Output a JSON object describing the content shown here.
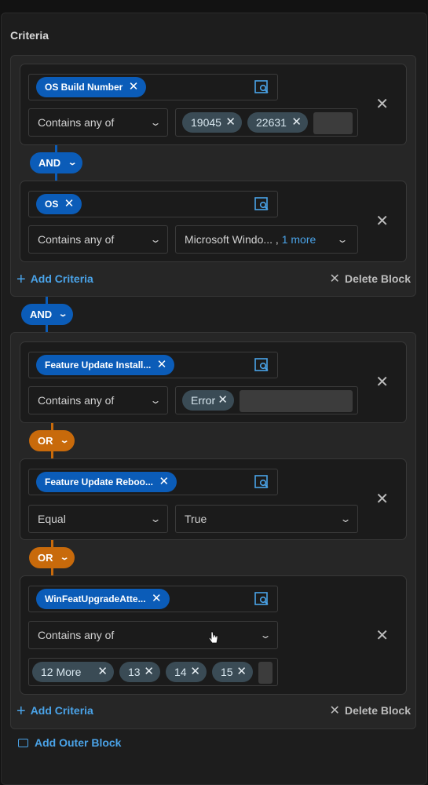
{
  "title": "Criteria",
  "colors": {
    "and": "#0b5cb8",
    "or": "#c86a0b",
    "link": "#4aa3e8"
  },
  "blocks": [
    {
      "criteria": [
        {
          "field": "OS Build Number",
          "operator": "Contains any of",
          "values": [
            "19045",
            "22631"
          ]
        },
        {
          "field": "OS",
          "operator": "Contains any of",
          "value_text": "Microsoft Windo... ,",
          "more": "1 more"
        }
      ],
      "join": "AND",
      "add_label": "Add Criteria",
      "delete_label": "Delete Block"
    },
    {
      "criteria": [
        {
          "field": "Feature Update Install...",
          "operator": "Contains any of",
          "values": [
            "Error"
          ]
        },
        {
          "field": "Feature Update Reboo...",
          "operator": "Equal",
          "value_select": "True"
        },
        {
          "field": "WinFeatUpgradeAtte...",
          "operator": "Contains any of",
          "values": [
            "12 More",
            "13",
            "14",
            "15"
          ]
        }
      ],
      "join": "OR",
      "add_label": "Add Criteria",
      "delete_label": "Delete Block"
    }
  ],
  "outer_join": "AND",
  "add_outer_label": "Add Outer Block",
  "icons": {
    "remove": "close-icon",
    "finder": "field-finder-icon",
    "expand": "chevron-down-icon",
    "add": "plus-icon",
    "outer": "add-block-icon"
  }
}
